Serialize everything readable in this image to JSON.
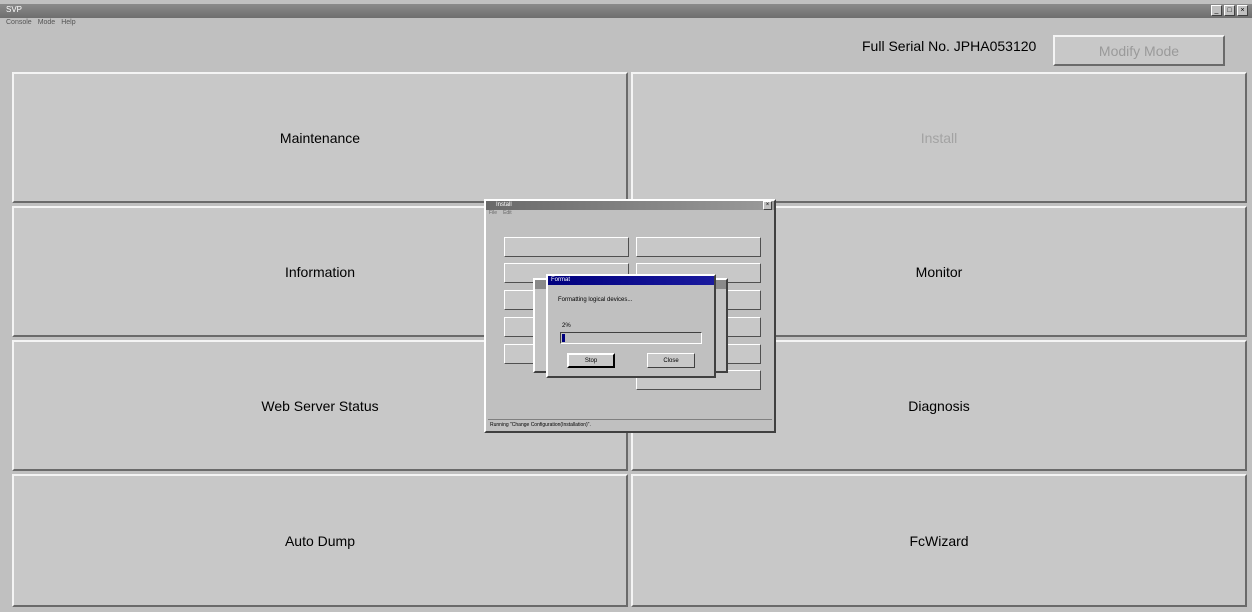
{
  "window": {
    "title": "SVP",
    "controls": [
      "_",
      "□",
      "×"
    ]
  },
  "menu": [
    "Console",
    "Mode",
    "Help"
  ],
  "header": {
    "serial_text": "Full Serial No. JPHA053120",
    "modify_mode_label": "Modify Mode"
  },
  "tiles": {
    "maintenance": "Maintenance",
    "install": "Install",
    "information": "Information",
    "monitor": "Monitor",
    "web_server_status": "Web Server Status",
    "diagnosis": "Diagnosis",
    "auto_dump": "Auto Dump",
    "fcwizard": "FcWizard"
  },
  "install_dialog": {
    "title": "Install",
    "menu": [
      "File",
      "Edit"
    ],
    "status": "Running \"Change Configuration(Installation)\"."
  },
  "format_dialog": {
    "title": "Format",
    "message": "Formatting logical devices...",
    "percent": "2%",
    "progress_fraction": 0.02,
    "stop_label": "Stop",
    "close_label": "Close"
  }
}
